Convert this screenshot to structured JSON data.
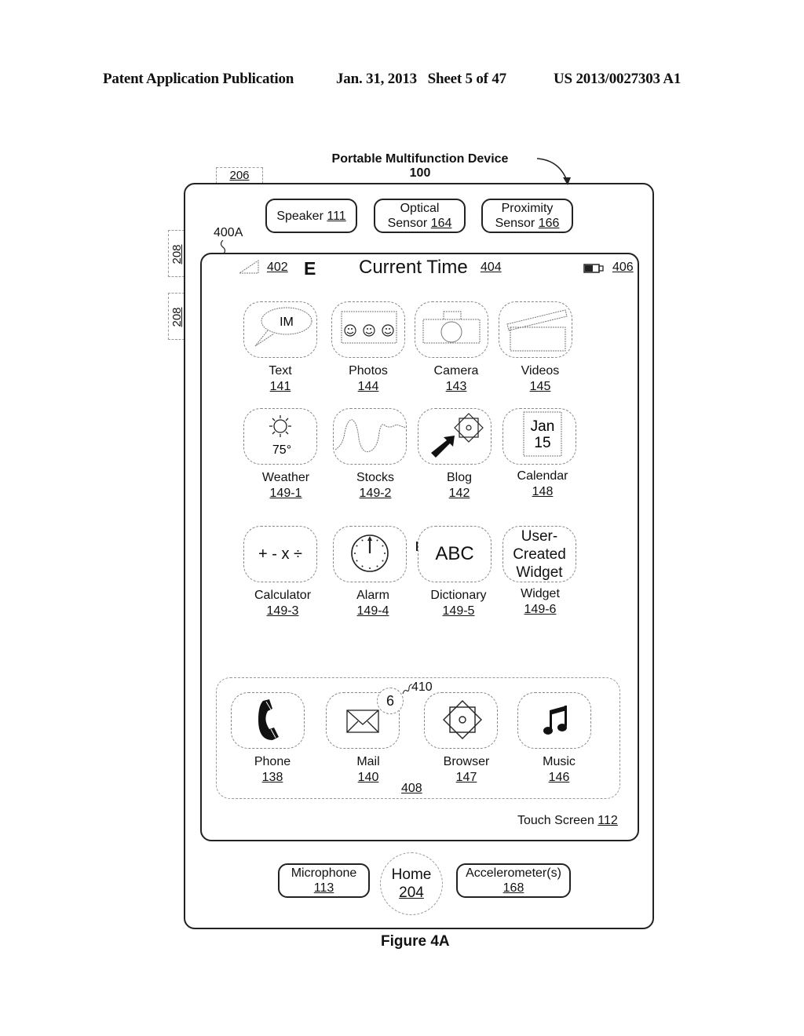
{
  "header": {
    "left": "Patent Application Publication",
    "date_sheet": "Jan. 31, 2013   Sheet 5 of 47",
    "pub_number": "US 2013/0027303 A1"
  },
  "device": {
    "title": "Portable Multifunction Device",
    "ref": "100",
    "tab_206": "206",
    "side_button_1": "208",
    "side_button_2": "208",
    "screen_ref": "400A"
  },
  "sensors": [
    {
      "line1": "Speaker",
      "ref": "111"
    },
    {
      "line1": "Optical",
      "line2": "Sensor",
      "ref": "164"
    },
    {
      "line1": "Proximity",
      "line2": "Sensor",
      "ref": "166"
    }
  ],
  "status_bar": {
    "signal_ref": "402",
    "network": "E",
    "time_label": "Current Time",
    "time_ref": "404",
    "battery_ref": "406"
  },
  "apps": [
    {
      "name": "Text",
      "ref": "141",
      "icon": "text-im-icon",
      "glyph": "IM"
    },
    {
      "name": "Photos",
      "ref": "144",
      "icon": "photos-icon"
    },
    {
      "name": "Camera",
      "ref": "143",
      "icon": "camera-icon"
    },
    {
      "name": "Videos",
      "ref": "145",
      "icon": "videos-icon"
    },
    {
      "name": "Weather",
      "ref": "149-1",
      "icon": "weather-sun-icon",
      "glyph": "75°"
    },
    {
      "name": "Stocks",
      "ref": "149-2",
      "icon": "stocks-chart-icon"
    },
    {
      "name": "Blog",
      "ref": "142",
      "icon": "blog-icon"
    },
    {
      "name": "Calendar",
      "ref": "148",
      "icon": "calendar-icon",
      "glyph_month": "Jan",
      "glyph_day": "15"
    },
    {
      "name": "Calculator",
      "ref": "149-3",
      "icon": "calculator-icon",
      "glyph": "+ - x ÷"
    },
    {
      "name": "Alarm",
      "ref": "149-4",
      "icon": "alarm-clock-icon"
    },
    {
      "name": "Dictionary",
      "ref": "149-5",
      "icon": "dictionary-icon",
      "glyph": "ABC"
    },
    {
      "name": "Widget",
      "ref": "149-6",
      "icon": "user-widget-icon",
      "glyph_lines": [
        "User-",
        "Created",
        "Widget"
      ]
    }
  ],
  "dock": {
    "ref": "408",
    "badge_count": "6",
    "badge_ref": "410",
    "apps": [
      {
        "name": "Phone",
        "ref": "138",
        "icon": "phone-icon"
      },
      {
        "name": "Mail",
        "ref": "140",
        "icon": "mail-envelope-icon"
      },
      {
        "name": "Browser",
        "ref": "147",
        "icon": "browser-compass-icon"
      },
      {
        "name": "Music",
        "ref": "146",
        "icon": "music-note-icon"
      }
    ]
  },
  "touch_screen": {
    "label": "Touch Screen",
    "ref": "112"
  },
  "bottom_hw": {
    "microphone": {
      "label": "Microphone",
      "ref": "113"
    },
    "home": {
      "label": "Home",
      "ref": "204"
    },
    "accelerometer": {
      "label": "Accelerometer(s)",
      "ref": "168"
    }
  },
  "figure_caption": "Figure 4A"
}
